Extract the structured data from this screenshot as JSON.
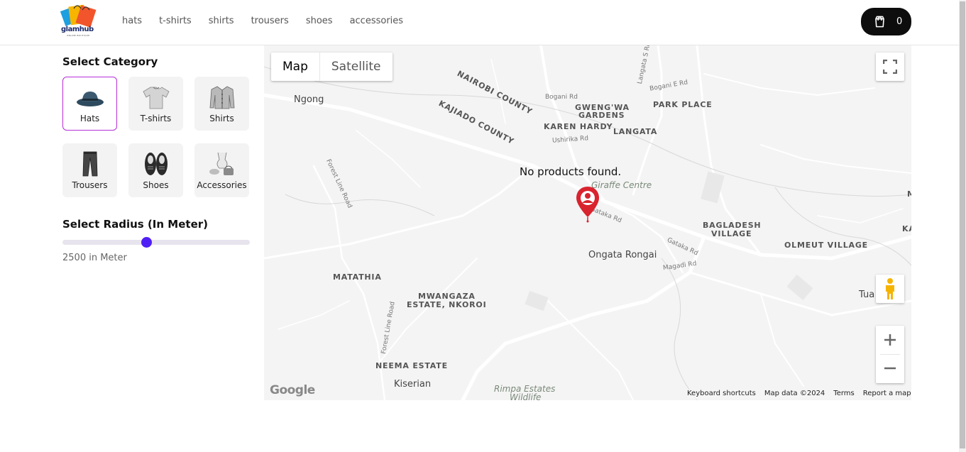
{
  "header": {
    "logo_text": "glamhub",
    "logo_sub": "ONLINE BOUTIQUE",
    "nav": [
      "hats",
      "t-shirts",
      "shirts",
      "trousers",
      "shoes",
      "accessories"
    ],
    "cart_count": "0"
  },
  "sidebar": {
    "category_title": "Select Category",
    "categories": [
      {
        "label": "Hats",
        "icon": "hat-icon",
        "active": true
      },
      {
        "label": "T-shirts",
        "icon": "tshirt-icon",
        "active": false
      },
      {
        "label": "Shirts",
        "icon": "shirt-icon",
        "active": false
      },
      {
        "label": "Trousers",
        "icon": "trousers-icon",
        "active": false
      },
      {
        "label": "Shoes",
        "icon": "shoes-icon",
        "active": false
      },
      {
        "label": "Accessories",
        "icon": "accessories-icon",
        "active": false
      }
    ],
    "radius_title": "Select Radius (In Meter)",
    "radius_value": 2500,
    "radius_text": "2500 in Meter"
  },
  "map": {
    "toggle": {
      "map": "Map",
      "satellite": "Satellite"
    },
    "message": "No products found.",
    "labels": {
      "ngong": "Ngong",
      "nairobi_county": "NAIROBI COUNTY",
      "kajiado_county": "KAJIADO COUNTY",
      "gwengwa": "GWENG'WA",
      "gardens": "GARDENS",
      "karen_hardy": "KAREN HARDY",
      "langata": "LANGATA",
      "park_place": "PARK PLACE",
      "bogani_rd": "Bogani Rd",
      "bogani_e_rd": "Bogani E Rd",
      "ushirika_rd": "Ushirika Rd",
      "langata_s_rd": "Langata S Rd",
      "forest_line_rd": "Forest Line Road",
      "forest_line_rd2": "Forest Line Road",
      "giraffe_centre": "Giraffe Centre",
      "gataka_rd": "Gataka Rd",
      "gataka_rd2": "Gataka Rd",
      "magadi_rd": "Magadi Rd",
      "kiserian_rd": "Rd",
      "bagladesh": "BAGLADESH",
      "village": "VILLAGE",
      "olmeut": "OLMEUT VILLAGE",
      "ongata_rongai": "Ongata Rongai",
      "matathia": "MATATHIA",
      "mwangaza": "MWANGAZA",
      "estate_nkoroi": "ESTATE, NKOROI",
      "neema": "NEEMA ESTATE",
      "kiserian": "Kiserian",
      "rimpa": "Rimpa Estates",
      "wildlife": "Wildlife",
      "tua": "Tua",
      "edge_m": "M",
      "edge_ka": "KA"
    },
    "google": "Google",
    "attribution": [
      "Keyboard shortcuts",
      "Map data ©2024",
      "Terms",
      "Report a map error"
    ]
  }
}
